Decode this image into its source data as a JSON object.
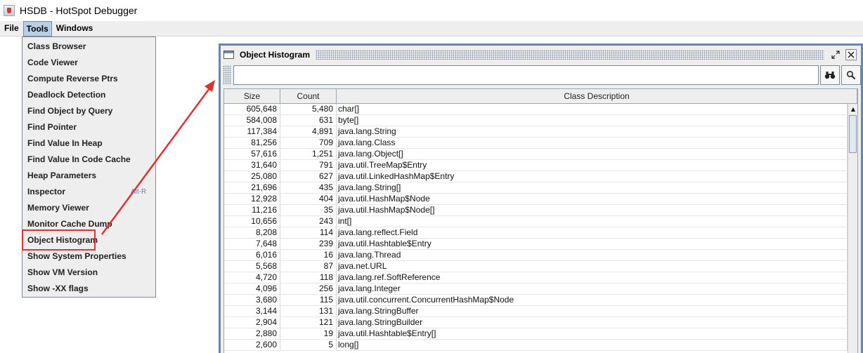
{
  "window": {
    "title": "HSDB - HotSpot Debugger"
  },
  "menubar": {
    "items": [
      "File",
      "Tools",
      "Windows"
    ]
  },
  "tools_menu": {
    "items": [
      {
        "label": "Class Browser",
        "accel": ""
      },
      {
        "label": "Code Viewer",
        "accel": ""
      },
      {
        "label": "Compute Reverse Ptrs",
        "accel": ""
      },
      {
        "label": "Deadlock Detection",
        "accel": ""
      },
      {
        "label": "Find Object by Query",
        "accel": ""
      },
      {
        "label": "Find Pointer",
        "accel": ""
      },
      {
        "label": "Find Value In Heap",
        "accel": ""
      },
      {
        "label": "Find Value In Code Cache",
        "accel": ""
      },
      {
        "label": "Heap Parameters",
        "accel": ""
      },
      {
        "label": "Inspector",
        "accel": "Alt-R"
      },
      {
        "label": "Memory Viewer",
        "accel": ""
      },
      {
        "label": "Monitor Cache Dump",
        "accel": ""
      },
      {
        "label": "Object Histogram",
        "accel": ""
      },
      {
        "label": "Show System Properties",
        "accel": ""
      },
      {
        "label": "Show VM Version",
        "accel": ""
      },
      {
        "label": "Show -XX flags",
        "accel": ""
      }
    ]
  },
  "histogram": {
    "title": "Object Histogram",
    "find_value": "",
    "icons": {
      "find": "binoculars-icon",
      "zoom": "magnifier-icon"
    },
    "columns": [
      "Size",
      "Count",
      "Class Description"
    ],
    "rows": [
      {
        "size": "605,648",
        "count": "5,480",
        "desc": "char[]"
      },
      {
        "size": "584,008",
        "count": "631",
        "desc": "byte[]"
      },
      {
        "size": "117,384",
        "count": "4,891",
        "desc": "java.lang.String"
      },
      {
        "size": "81,256",
        "count": "709",
        "desc": "java.lang.Class"
      },
      {
        "size": "57,616",
        "count": "1,251",
        "desc": "java.lang.Object[]"
      },
      {
        "size": "31,640",
        "count": "791",
        "desc": "java.util.TreeMap$Entry"
      },
      {
        "size": "25,080",
        "count": "627",
        "desc": "java.util.LinkedHashMap$Entry"
      },
      {
        "size": "21,696",
        "count": "435",
        "desc": "java.lang.String[]"
      },
      {
        "size": "12,928",
        "count": "404",
        "desc": "java.util.HashMap$Node"
      },
      {
        "size": "11,216",
        "count": "35",
        "desc": "java.util.HashMap$Node[]"
      },
      {
        "size": "10,656",
        "count": "243",
        "desc": "int[]"
      },
      {
        "size": "8,208",
        "count": "114",
        "desc": "java.lang.reflect.Field"
      },
      {
        "size": "7,648",
        "count": "239",
        "desc": "java.util.Hashtable$Entry"
      },
      {
        "size": "6,016",
        "count": "16",
        "desc": "java.lang.Thread"
      },
      {
        "size": "5,568",
        "count": "87",
        "desc": "java.net.URL"
      },
      {
        "size": "4,720",
        "count": "118",
        "desc": "java.lang.ref.SoftReference"
      },
      {
        "size": "4,096",
        "count": "256",
        "desc": "java.lang.Integer"
      },
      {
        "size": "3,680",
        "count": "115",
        "desc": "java.util.concurrent.ConcurrentHashMap$Node"
      },
      {
        "size": "3,144",
        "count": "131",
        "desc": "java.lang.StringBuffer"
      },
      {
        "size": "2,904",
        "count": "121",
        "desc": "java.lang.StringBuilder"
      },
      {
        "size": "2,880",
        "count": "19",
        "desc": "java.util.Hashtable$Entry[]"
      },
      {
        "size": "2,600",
        "count": "5",
        "desc": "long[]"
      }
    ]
  },
  "colors": {
    "annotation": "#e03030",
    "frame_border": "#6b86a8",
    "menu_active": "#b8cfe5"
  }
}
